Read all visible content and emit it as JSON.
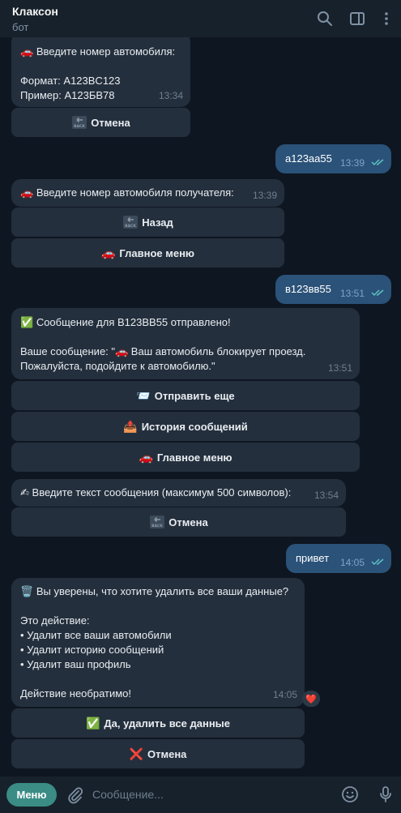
{
  "header": {
    "title": "Клаксон",
    "subtitle": "бот",
    "icons": [
      "search-icon",
      "sidebar-toggle-icon",
      "more-icon"
    ]
  },
  "messages": [
    {
      "from": "bot",
      "emoji": "🚗",
      "text": "Введите номер автомобиля:\n\nФормат: A123BC123\nПример: А123БВ78",
      "time": "13:34",
      "buttons": [
        {
          "icon": "back-icon",
          "label": "Отмена"
        }
      ]
    },
    {
      "from": "user",
      "text": "а123аа55",
      "time": "13:39",
      "status": "read"
    },
    {
      "from": "bot",
      "emoji": "🚗",
      "text": "Введите номер автомобиля получателя:",
      "time": "13:39",
      "buttons": [
        {
          "icon": "back-icon",
          "label": "Назад"
        },
        {
          "emoji": "🚗",
          "label": "Главное меню"
        }
      ]
    },
    {
      "from": "user",
      "text": "в123вв55",
      "time": "13:51",
      "status": "read"
    },
    {
      "from": "bot",
      "emoji": "✅",
      "text": "Сообщение для В123ВВ55 отправлено!\n\nВаше сообщение: \"🚗 Ваш автомобиль блокирует проезд. Пожалуйста, подойдите к автомобилю.\"",
      "time": "13:51",
      "buttons": [
        {
          "emoji": "📨",
          "label": "Отправить еще"
        },
        {
          "emoji": "📤",
          "label": "История сообщений"
        },
        {
          "emoji": "🚗",
          "label": "Главное меню"
        }
      ]
    },
    {
      "from": "bot",
      "emoji": "✍",
      "text": "Введите текст сообщения (максимум 500 символов):",
      "time": "13:54",
      "buttons": [
        {
          "icon": "back-icon",
          "label": "Отмена"
        }
      ]
    },
    {
      "from": "user",
      "text": "привет",
      "time": "14:05",
      "status": "read"
    },
    {
      "from": "bot",
      "emoji": "🗑️",
      "text": "Вы уверены, что хотите удалить все ваши данные?\n\nЭто действие:\n• Удалит все ваши автомобили\n• Удалит историю сообщений\n• Удалит ваш профиль\n\nДействие необратимо!",
      "time": "14:05",
      "reaction": "❤️",
      "buttons": [
        {
          "emoji": "✅",
          "label": "Да, удалить все данные"
        },
        {
          "emoji": "❌",
          "label": "Отмена"
        }
      ]
    }
  ],
  "composer": {
    "menu_label": "Меню",
    "placeholder": "Сообщение...",
    "icons": [
      "attach-icon",
      "emoji-icon",
      "mic-icon"
    ]
  },
  "colors": {
    "background": "#0e1621",
    "header": "#17212b",
    "bubble_in": "#242f3d",
    "bubble_out": "#2b5278",
    "menu_button": "#3a8c85",
    "read_ticks": "#5ec1c4"
  }
}
